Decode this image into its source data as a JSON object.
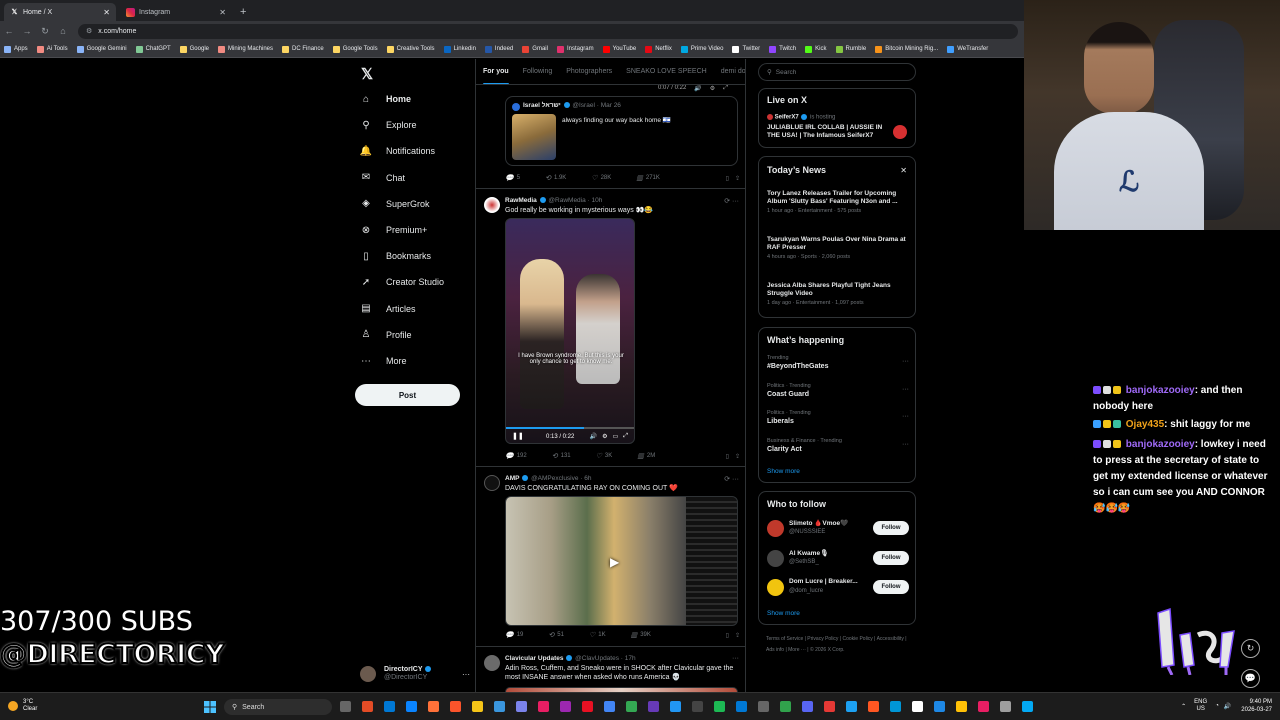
{
  "browser": {
    "tabs": [
      {
        "label": "Home / X",
        "icon": "x-logo-icon",
        "active": true
      },
      {
        "label": "Instagram",
        "icon": "instagram-icon",
        "active": false
      }
    ],
    "url": "x.com/home",
    "bookmarks": [
      "Apps",
      "Ai Tools",
      "Google Gemini",
      "ChatGPT",
      "Google",
      "Mining Machines",
      "DC Finance",
      "Google Tools",
      "Creative Tools",
      "Linkedin",
      "Indeed",
      "Gmail",
      "Instagram",
      "YouTube",
      "Netflix",
      "Prime Video",
      "Twitter",
      "Twitch",
      "Kick",
      "Rumble",
      "Bitcoin Mining Rig...",
      "WeTransfer"
    ]
  },
  "nav": {
    "items": [
      {
        "label": "Home",
        "icon": "home-icon",
        "glyph": "⌂"
      },
      {
        "label": "Explore",
        "icon": "search-icon",
        "glyph": "⚲"
      },
      {
        "label": "Notifications",
        "icon": "bell-icon",
        "glyph": "🔔"
      },
      {
        "label": "Chat",
        "icon": "mail-icon",
        "glyph": "✉"
      },
      {
        "label": "SuperGrok",
        "icon": "grok-icon",
        "glyph": "◈"
      },
      {
        "label": "Premium+",
        "icon": "premium-icon",
        "glyph": "⊗"
      },
      {
        "label": "Bookmarks",
        "icon": "bookmark-icon",
        "glyph": "▯"
      },
      {
        "label": "Creator Studio",
        "icon": "rocket-icon",
        "glyph": "➚"
      },
      {
        "label": "Articles",
        "icon": "articles-icon",
        "glyph": "▤"
      },
      {
        "label": "Profile",
        "icon": "profile-icon",
        "glyph": "♙"
      },
      {
        "label": "More",
        "icon": "more-icon",
        "glyph": "⋯"
      }
    ],
    "post_label": "Post",
    "account": {
      "name": "DirectorICY",
      "handle": "@DirectorICY"
    }
  },
  "overlay": {
    "subs": "307/300 SUBS",
    "handle": "@DIRECTORICY"
  },
  "timeline": {
    "tabs": [
      "For you",
      "Following",
      "Photographers",
      "SNEAKO LOVE SPEECH",
      "demi dog"
    ],
    "quote_post": {
      "name": "Israel ישראל",
      "handle": "@Israel",
      "date": "Mar 26",
      "text": "always finding our way back home 🇮🇱",
      "replies": "5",
      "reposts": "1.9K",
      "likes": "28K",
      "views": "271K",
      "video_time": "0:07 / 0:22"
    },
    "post2": {
      "name": "RawMedia",
      "handle": "@RawMedia",
      "time": "10h",
      "text": "God really be working in mysterious ways 👀😂",
      "caption": "I have Brown syndrome. But this is your only chance to get to know me.",
      "video_time": "0:13 / 0:22",
      "replies": "192",
      "reposts": "131",
      "likes": "3K",
      "views": "2M"
    },
    "post3": {
      "name": "AMP",
      "handle": "@AMPexclusive",
      "time": "6h",
      "text": "DAVIS CONGRATULATING RAY ON COMING OUT ❤️",
      "replies": "19",
      "reposts": "51",
      "likes": "1K",
      "views": "39K"
    },
    "post4": {
      "name": "Clavicular Updates",
      "handle": "@ClavUpdates",
      "time": "17h",
      "text": "Adin Ross, Cuffem, and Sneako were in SHOCK after Clavicular gave the most INSANE answer when asked who runs America 💀"
    }
  },
  "sidebar": {
    "search_placeholder": "Search",
    "live": {
      "title": "Live on X",
      "host": "SeiferX7",
      "hosting": "is hosting",
      "text": "JULIABLUE IRL COLLAB | AUSSIE IN THE USA! | The Infamous SeiferX7"
    },
    "news": {
      "title": "Today’s News",
      "items": [
        {
          "title": "Tory Lanez Releases Trailer for Upcoming Album 'Slutty Bass' Featuring N3on and ...",
          "meta": "1 hour ago · Entertainment · 575 posts"
        },
        {
          "title": "Tsarukyan Warns Poulas Over Nina Drama at RAF Presser",
          "meta": "4 hours ago · Sports · 2,060 posts"
        },
        {
          "title": "Jessica Alba Shares Playful Tight Jeans Struggle Video",
          "meta": "1 day ago · Entertainment · 1,097 posts"
        }
      ]
    },
    "happening": {
      "title": "What’s happening",
      "items": [
        {
          "category": "Trending",
          "title": "#BeyondTheGates"
        },
        {
          "category": "Politics · Trending",
          "title": "Coast Guard"
        },
        {
          "category": "Politics · Trending",
          "title": "Liberals"
        },
        {
          "category": "Business & Finance · Trending",
          "title": "Clarity Act"
        }
      ],
      "show_more": "Show more"
    },
    "who_to_follow": {
      "title": "Who to follow",
      "items": [
        {
          "name": "Slimeto 🩸Vmoe🖤",
          "handle": "@NUSSSIEE"
        },
        {
          "name": "Al Kwame🎙",
          "handle": "@SethSB_"
        },
        {
          "name": "Dom Lucre | Breaker...",
          "handle": "@dom_lucre"
        }
      ],
      "follow_label": "Follow",
      "show_more": "Show more"
    },
    "footer": "Terms of Service | Privacy Policy | Cookie Policy | Accessibility | Ads info | More ··· | © 2026 X Corp."
  },
  "chat": {
    "messages": [
      {
        "user": "banjokazooiey",
        "text": ": and then nobody here"
      },
      {
        "user": "Ojay435",
        "text": ": shit laggy for me"
      },
      {
        "user": "banjokazooiey",
        "text": ": lowkey i need to press at the secretary of state to get my extended license or whatever so i can cum see you AND CONNOR 🥵🥵🥵"
      }
    ]
  },
  "taskbar": {
    "weather_temp": "3°C",
    "weather_desc": "Clear",
    "search": "Search",
    "lang": "ENG",
    "region": "US",
    "time": "9:40 PM",
    "date": "2026-03-27"
  },
  "colors": {
    "accent": "#1d9bf0",
    "chat_user": "#9f6af7",
    "chat_user2": "#f0a21a"
  }
}
